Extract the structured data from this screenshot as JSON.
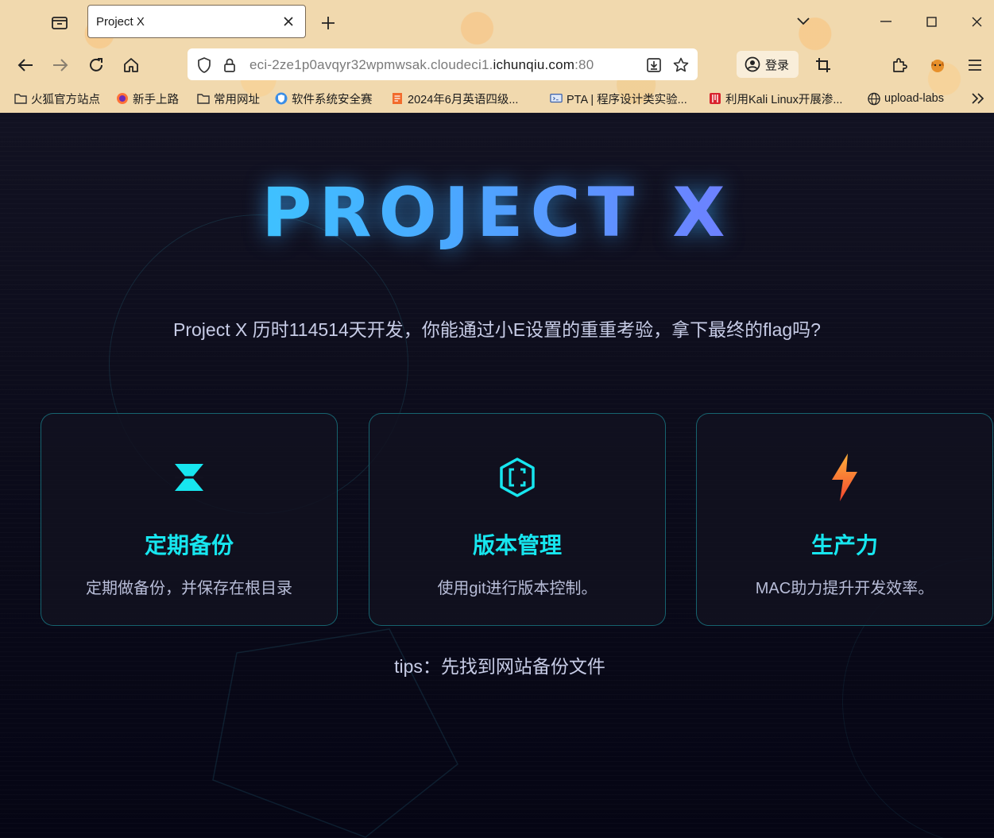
{
  "browser": {
    "tab": {
      "title": "Project X",
      "close_icon": "close-icon"
    },
    "window_controls": [
      "chevron-down-icon",
      "minimize-icon",
      "maximize-icon",
      "close-icon"
    ],
    "url": {
      "host_prefix": "eci-2ze1p0avqyr32wpmwsak.cloudeci1.",
      "domain": "ichunqiu.com",
      "port": ":80"
    },
    "login_label": "登录",
    "bookmarks": [
      {
        "label": "火狐官方站点",
        "icon": "folder-icon"
      },
      {
        "label": "新手上路",
        "icon": "firefox-icon"
      },
      {
        "label": "常用网址",
        "icon": "folder-icon"
      },
      {
        "label": "软件系统安全赛",
        "icon": "shield-icon"
      },
      {
        "label": "2024年6月英语四级...",
        "icon": "doc-icon"
      },
      {
        "label": "PTA | 程序设计类实验...",
        "icon": "pta-icon"
      },
      {
        "label": "利用Kali Linux开展渗...",
        "icon": "kali-icon"
      },
      {
        "label": "upload-labs",
        "icon": "globe-icon"
      }
    ]
  },
  "page": {
    "title": "PROJECT X",
    "subtitle": "Project X 历时114514天开发，你能通过小E设置的重重考验，拿下最终的flag吗?",
    "cards": [
      {
        "icon": "hourglass-icon",
        "title": "定期备份",
        "desc": "定期做备份，并保存在根目录"
      },
      {
        "icon": "code-hexagon-icon",
        "title": "版本管理",
        "desc": "使用git进行版本控制。"
      },
      {
        "icon": "lightning-icon",
        "title": "生产力",
        "desc": "MAC助力提升开发效率。"
      }
    ],
    "tips": "tips：先找到网站备份文件"
  },
  "colors": {
    "accent": "#17e6ef",
    "title_gradient_start": "#2ee6ff",
    "title_gradient_end": "#8f5bff",
    "background": "#0b0b1a"
  }
}
